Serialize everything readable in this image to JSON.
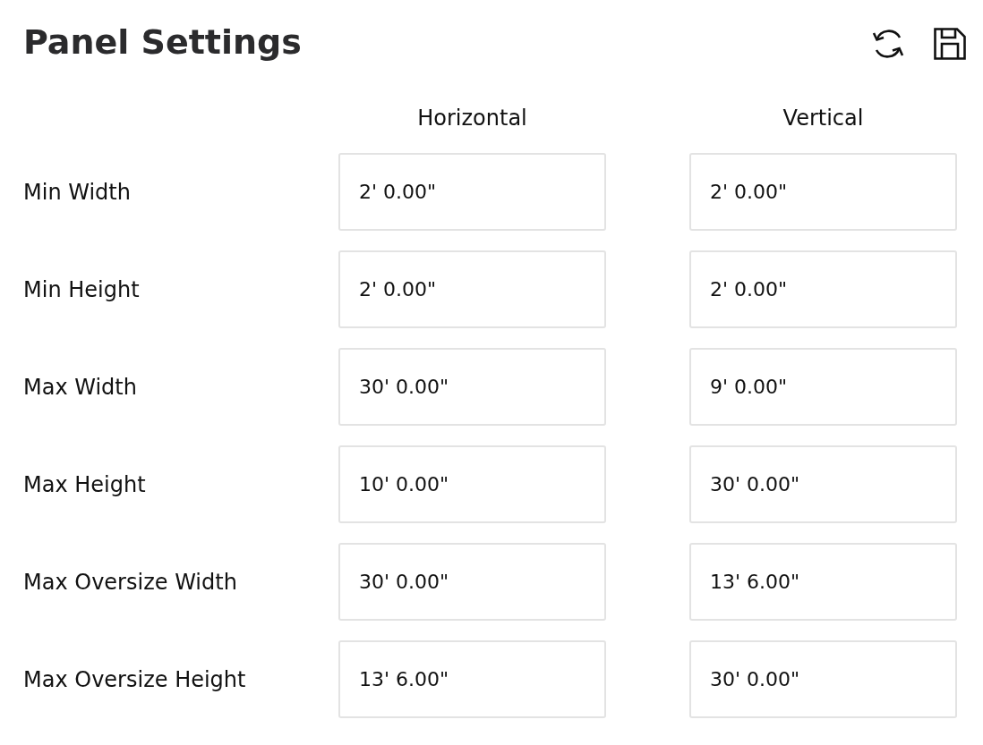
{
  "title": "Panel Settings",
  "columns": [
    "Horizontal",
    "Vertical"
  ],
  "rows": [
    {
      "label": "Min Width",
      "values": [
        "2' 0.00\"",
        "2' 0.00\""
      ]
    },
    {
      "label": "Min Height",
      "values": [
        "2' 0.00\"",
        "2' 0.00\""
      ]
    },
    {
      "label": "Max Width",
      "values": [
        "30' 0.00\"",
        "9' 0.00\""
      ]
    },
    {
      "label": "Max Height",
      "values": [
        "10' 0.00\"",
        "30' 0.00\""
      ]
    },
    {
      "label": "Max Oversize Width",
      "values": [
        "30' 0.00\"",
        "13' 6.00\""
      ]
    },
    {
      "label": "Max Oversize Height",
      "values": [
        "13' 6.00\"",
        "30' 0.00\""
      ]
    }
  ]
}
